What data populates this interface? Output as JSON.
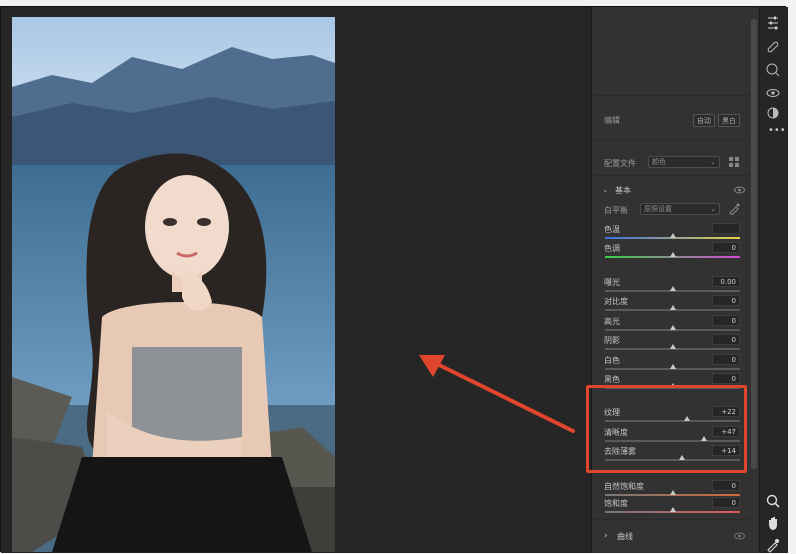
{
  "panel": {
    "edit_label": "编辑",
    "auto_button": "自动",
    "bw_button": "黑白",
    "profile_label": "配置文件",
    "profile_value": "颜色",
    "basic_label": "基本",
    "white_balance_label": "白平衡",
    "white_balance_value": "原照设置",
    "curves_label": "曲线"
  },
  "sliders": [
    {
      "label": "色温",
      "value": "",
      "level": 0.5
    },
    {
      "label": "色调",
      "value": "0",
      "level": 0.5
    },
    {
      "label": "曝光",
      "value": "0.00",
      "level": 0.5
    },
    {
      "label": "对比度",
      "value": "0",
      "level": 0.5
    },
    {
      "label": "高光",
      "value": "0",
      "level": 0.5
    },
    {
      "label": "阴影",
      "value": "0",
      "level": 0.5
    },
    {
      "label": "白色",
      "value": "0",
      "level": 0.5
    },
    {
      "label": "黑色",
      "value": "0",
      "level": 0.5
    },
    {
      "label": "纹理",
      "value": "+22",
      "level": 0.61
    },
    {
      "label": "清晰度",
      "value": "+47",
      "level": 0.735
    },
    {
      "label": "去除薄雾",
      "value": "+14",
      "level": 0.57
    },
    {
      "label": "自然饱和度",
      "value": "0",
      "level": 0.5
    },
    {
      "label": "饱和度",
      "value": "0",
      "level": 0.5
    }
  ],
  "colors": {
    "highlight": "#e0452d",
    "arrow": "#e0452d",
    "panel_bg": "#323232"
  },
  "icons": [
    "sliders-icon",
    "healing-icon",
    "mask-icon",
    "eye-icon",
    "redeye-icon",
    "more-icon",
    "zoom-icon",
    "hand-icon",
    "sampler-icon"
  ]
}
